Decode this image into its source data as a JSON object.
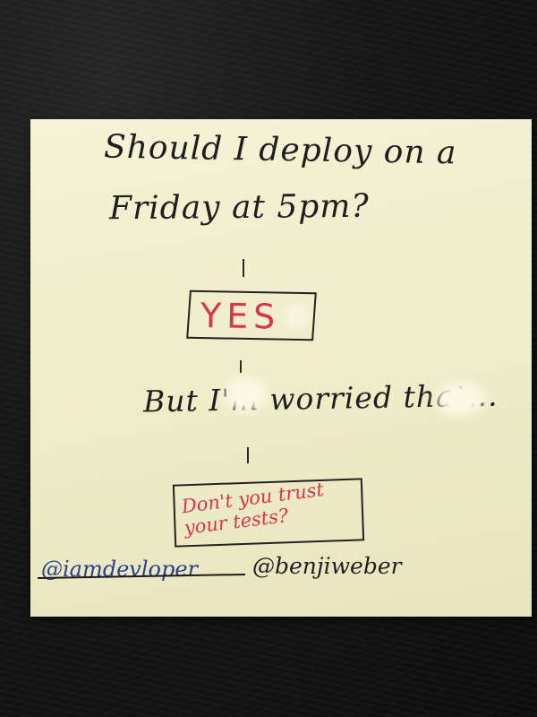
{
  "note": {
    "question_line1": "Should I deploy on a",
    "question_line2": "Friday at 5pm?",
    "answer": "YES",
    "worry": "But I'm worried that...",
    "retort": "Don't you trust\nyour tests?",
    "handle_old": "@iamdevloper",
    "handle_new": "@benjiweber"
  },
  "colors": {
    "ink": "#1e1e1e",
    "red_ink": "#d8344c",
    "blue_ink": "#2b3f8c",
    "paper": "#f2efcf",
    "desk": "#141414"
  }
}
